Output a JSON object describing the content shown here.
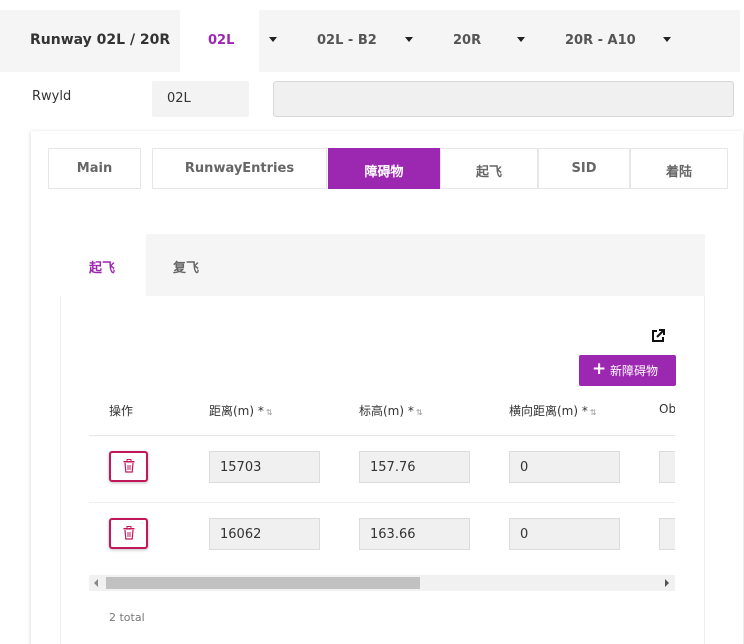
{
  "header": {
    "title": "Runway 02L / 20R",
    "runway_tabs": [
      {
        "label": "02L",
        "active": true
      },
      {
        "label": "02L - B2",
        "active": false
      },
      {
        "label": "20R",
        "active": false
      },
      {
        "label": "20R - A10",
        "active": false
      }
    ]
  },
  "rwy": {
    "label": "Rwyld",
    "value": "02L",
    "extra_value": ""
  },
  "main_tabs": [
    {
      "label": "Main",
      "active": false
    },
    {
      "label": "RunwayEntries",
      "active": false
    },
    {
      "label": "障碍物",
      "active": true
    },
    {
      "label": "起飞",
      "active": false
    },
    {
      "label": "SID",
      "active": false
    },
    {
      "label": "着陆",
      "active": false
    }
  ],
  "sub_tabs": [
    {
      "label": "起飞",
      "active": true
    },
    {
      "label": "复飞",
      "active": false
    }
  ],
  "toolbar": {
    "add_label": "新障碍物",
    "add_icon": "plus-icon",
    "external_icon": "external-link-icon"
  },
  "table": {
    "columns": [
      {
        "label": "操作",
        "sortable": false
      },
      {
        "label": "距离(m) *",
        "sortable": true
      },
      {
        "label": "标高(m) *",
        "sortable": true
      },
      {
        "label": "横向距离(m) *",
        "sortable": true
      },
      {
        "label": "Ob",
        "sortable": false
      }
    ],
    "rows": [
      {
        "distance": "15703",
        "elevation": "157.76",
        "lateral": "0"
      },
      {
        "distance": "16062",
        "elevation": "163.66",
        "lateral": "0"
      }
    ],
    "delete_icon": "trash-icon"
  },
  "footer": {
    "total": "2 total"
  },
  "colors": {
    "accent": "#9c27b0",
    "danger": "#c2185b"
  }
}
